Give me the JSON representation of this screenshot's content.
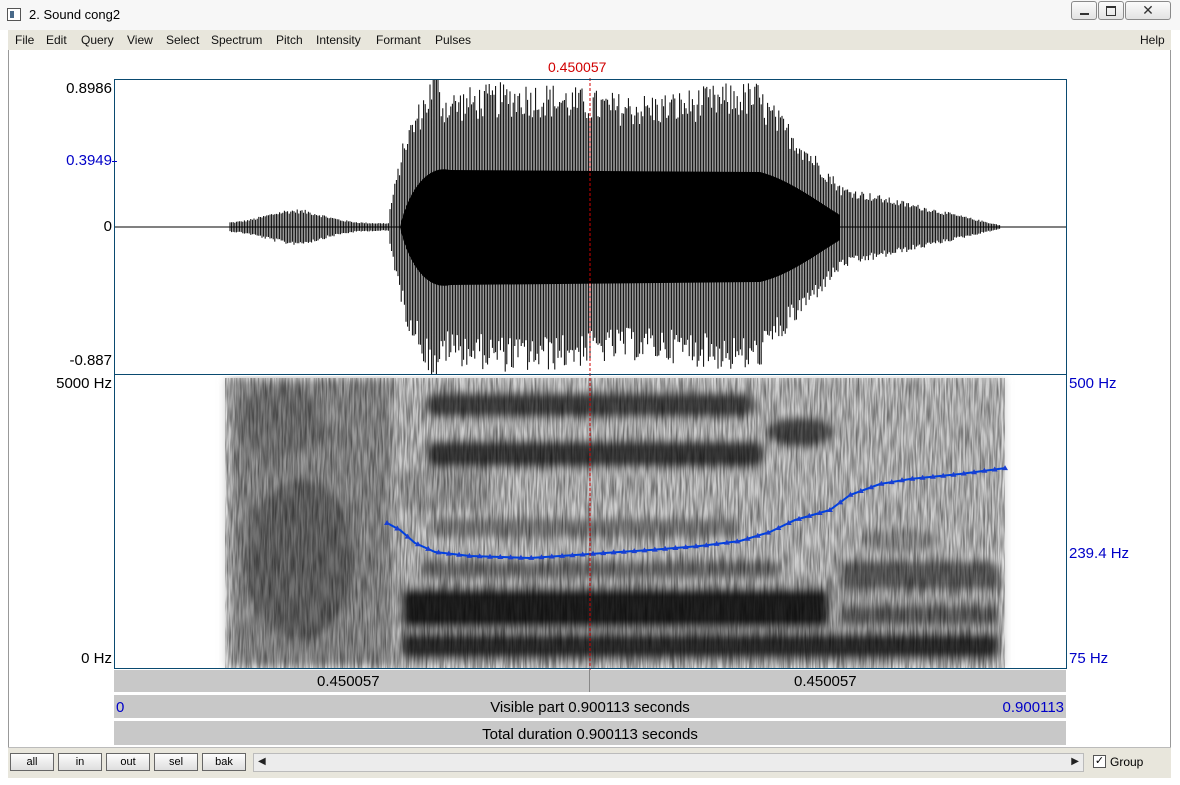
{
  "window": {
    "title": "2. Sound cong2"
  },
  "menu": [
    "File",
    "Edit",
    "Query",
    "View",
    "Select",
    "Spectrum",
    "Pitch",
    "Intensity",
    "Formant",
    "Pulses"
  ],
  "help_label": "Help",
  "cursor_time": "0.450057",
  "waveform": {
    "ymax": "0.8986",
    "mid_mark": "0.3949",
    "zero": "0",
    "ymin": "-0.887"
  },
  "spectrogram": {
    "fmax": "5000 Hz",
    "fmin": "0 Hz"
  },
  "pitch_axis": {
    "top": "500 Hz",
    "mid": "239.4 Hz",
    "bottom": "75 Hz"
  },
  "time_row": {
    "left": "0.450057",
    "right": "0.450057"
  },
  "visible_row": {
    "start": "0",
    "text": "Visible part 0.900113 seconds",
    "end": "0.900113"
  },
  "total_row": {
    "text": "Total duration 0.900113 seconds"
  },
  "buttons": {
    "all": "all",
    "in": "in",
    "out": "out",
    "sel": "sel",
    "bak": "bak"
  },
  "group_label": "Group",
  "colors": {
    "cursor": "#d00000",
    "pitch": "#0040e0",
    "axis_blue": "#0000c8"
  }
}
